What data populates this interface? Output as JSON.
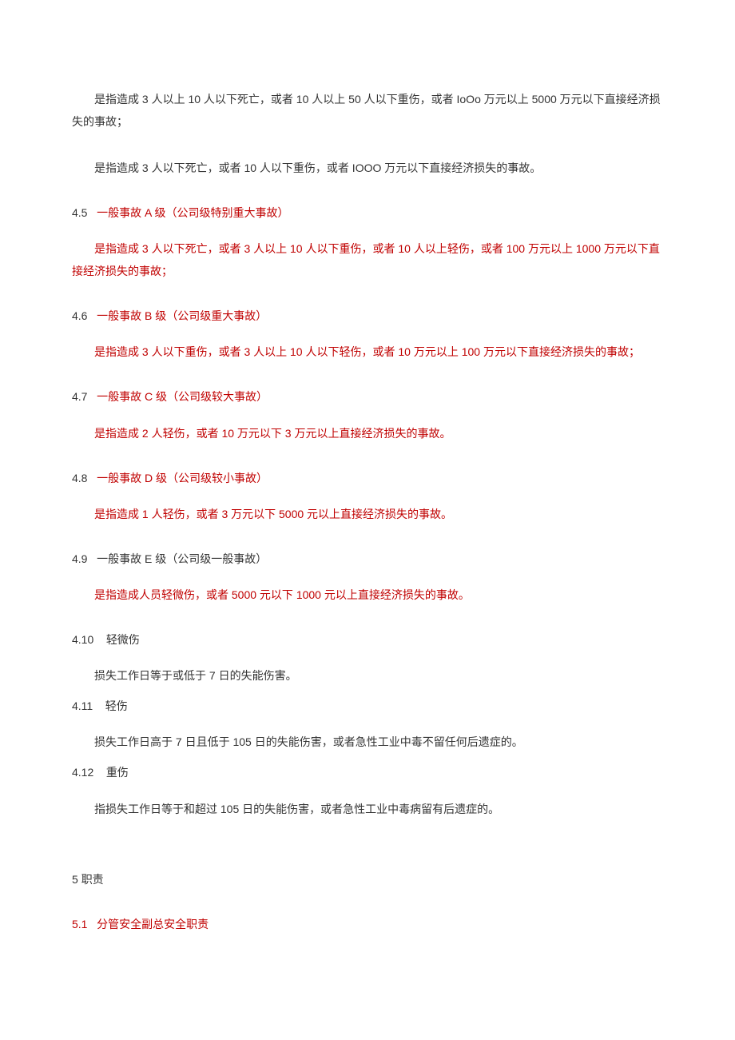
{
  "p1": "是指造成 3 人以上 10 人以下死亡，或者 10 人以上 50 人以下重伤，或者 IoOo 万元以上 5000 万元以下直接经济损失的事故；",
  "p2": "是指造成 3 人以下死亡，或者 10 人以下重伤，或者 IOOO 万元以下直接经济损失的事故。",
  "s45": {
    "num": "4.5",
    "title": "一般事故 A 级（公司级特别重大事故）",
    "body": "是指造成 3 人以下死亡，或者 3 人以上 10 人以下重伤，或者 10 人以上轻伤，或者 100 万元以上 1000 万元以下直接经济损失的事故；"
  },
  "s46": {
    "num": "4.6",
    "title": "一般事故 B 级（公司级重大事故）",
    "body": "是指造成 3 人以下重伤，或者 3 人以上 10 人以下轻伤，或者 10 万元以上 100 万元以下直接经济损失的事故；"
  },
  "s47": {
    "num": "4.7",
    "title": "一般事故 C 级（公司级较大事故）",
    "body": "是指造成 2 人轻伤，或者 10 万元以下 3 万元以上直接经济损失的事故。"
  },
  "s48": {
    "num": "4.8",
    "title": "一般事故 D 级（公司级较小事故）",
    "body": "是指造成 1 人轻伤，或者 3 万元以下 5000 元以上直接经济损失的事故。"
  },
  "s49": {
    "num": "4.9",
    "title": "一般事故 E 级（公司级一般事故）",
    "body": "是指造成人员轻微伤，或者 5000 元以下 1000 元以上直接经济损失的事故。"
  },
  "s410": {
    "num": "4.10",
    "title": "轻微伤",
    "body": "损失工作日等于或低于 7 日的失能伤害。"
  },
  "s411": {
    "num": "4.11",
    "title": "轻伤",
    "body": "损失工作日高于 7 日且低于 105 日的失能伤害，或者急性工业中毒不留任何后遗症的。"
  },
  "s412": {
    "num": "4.12",
    "title": "重伤",
    "body": "指损失工作日等于和超过 105 日的失能伤害，或者急性工业中毒病留有后遗症的。"
  },
  "s5": {
    "num": "5",
    "title": "职责"
  },
  "s51": {
    "num": "5.1",
    "title": "分管安全副总安全职责"
  }
}
